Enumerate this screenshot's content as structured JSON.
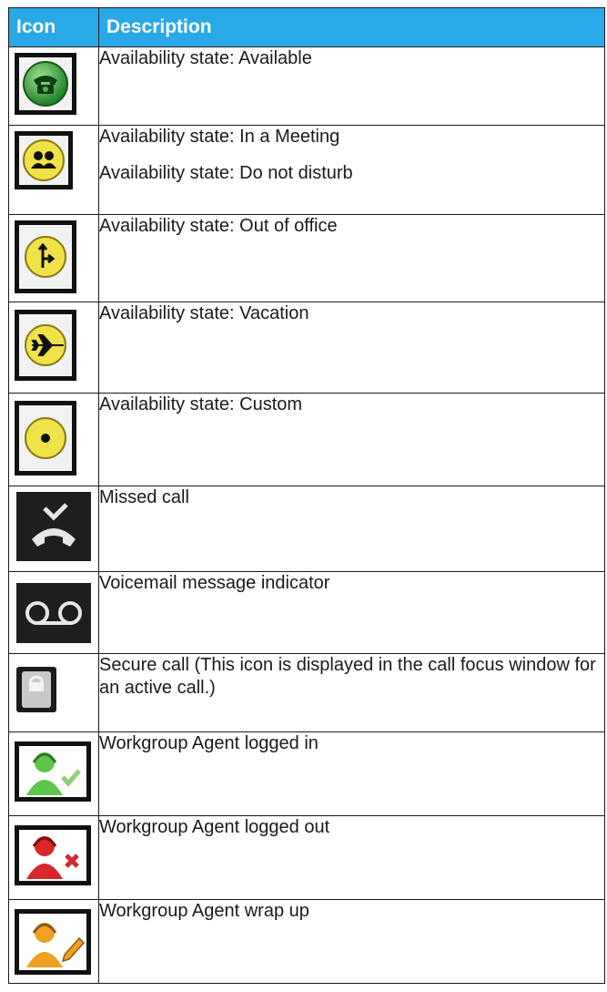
{
  "table": {
    "headers": {
      "icon": "Icon",
      "description": "Description"
    },
    "rows": [
      {
        "icon": "green-phone-icon",
        "lines": [
          "Availability state: Available"
        ]
      },
      {
        "icon": "meeting-people-icon",
        "lines": [
          "Availability state: In a Meeting",
          "Availability state: Do not disturb"
        ]
      },
      {
        "icon": "out-of-office-icon",
        "lines": [
          "Availability state: Out of office"
        ]
      },
      {
        "icon": "airplane-icon",
        "lines": [
          "Availability state: Vacation"
        ]
      },
      {
        "icon": "custom-dot-icon",
        "lines": [
          "Availability state: Custom"
        ]
      },
      {
        "icon": "missed-call-icon",
        "lines": [
          "Missed call"
        ]
      },
      {
        "icon": "voicemail-icon",
        "lines": [
          "Voicemail message indicator"
        ]
      },
      {
        "icon": "secure-lock-icon",
        "lines": [
          "Secure call (This icon is displayed in the call focus window for an active call.)"
        ]
      },
      {
        "icon": "agent-logged-in-icon",
        "lines": [
          "Workgroup Agent logged in"
        ]
      },
      {
        "icon": "agent-logged-out-icon",
        "lines": [
          "Workgroup Agent logged out"
        ]
      },
      {
        "icon": "agent-wrap-up-icon",
        "lines": [
          "Workgroup Agent wrap up"
        ]
      }
    ]
  },
  "colors": {
    "header_bg": "#2aa9e8",
    "available": "#2ea02e",
    "state_yellow": "#f2e24a",
    "logged_in": "#5cc54a",
    "logged_out": "#d8262a",
    "wrap_up": "#f0a020"
  }
}
